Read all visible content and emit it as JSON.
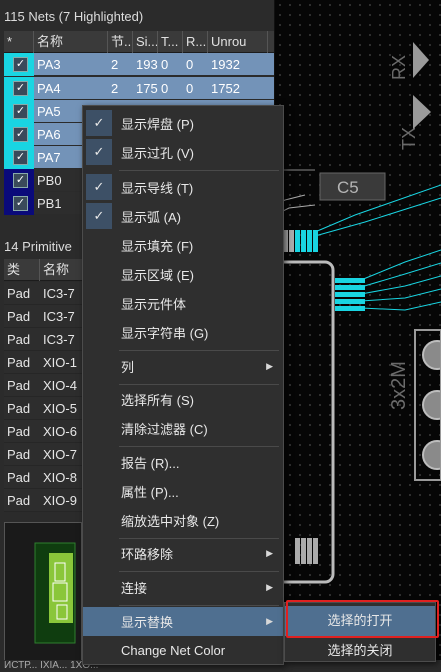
{
  "nets": {
    "title": "115 Nets (7 Highlighted)",
    "columns": [
      "*",
      "名称",
      "节...",
      "Si...",
      "T...",
      "R...",
      "Unrou"
    ],
    "rows": [
      {
        "name": "PA3",
        "nodes": "2",
        "signal": "193",
        "t": "0",
        "r": "0",
        "unrouted": "1932",
        "highlighted": true,
        "color": "#19d5e2"
      },
      {
        "name": "PA4",
        "nodes": "2",
        "signal": "175",
        "t": "0",
        "r": "0",
        "unrouted": "1752",
        "highlighted": true,
        "color": "#19d5e2"
      },
      {
        "name": "PA5",
        "nodes": "",
        "signal": "",
        "t": "",
        "r": "",
        "unrouted": "",
        "highlighted": true,
        "color": "#19d5e2"
      },
      {
        "name": "PA6",
        "nodes": "",
        "signal": "",
        "t": "",
        "r": "",
        "unrouted": "",
        "highlighted": true,
        "color": "#19d5e2"
      },
      {
        "name": "PA7",
        "nodes": "",
        "signal": "",
        "t": "",
        "r": "",
        "unrouted": "",
        "highlighted": true,
        "color": "#19d5e2"
      },
      {
        "name": "PB0",
        "nodes": "",
        "signal": "",
        "t": "",
        "r": "",
        "unrouted": "",
        "highlighted": false,
        "color": "#0a0a7a"
      },
      {
        "name": "PB1",
        "nodes": "",
        "signal": "",
        "t": "",
        "r": "",
        "unrouted": "",
        "highlighted": false,
        "color": "#0a0a7a"
      }
    ]
  },
  "primitives": {
    "title": "14 Primitive",
    "columns": [
      "类",
      "名称"
    ],
    "rows": [
      {
        "type": "Pad",
        "name": "IC3-7"
      },
      {
        "type": "Pad",
        "name": "IC3-7"
      },
      {
        "type": "Pad",
        "name": "IC3-7"
      },
      {
        "type": "Pad",
        "name": "XIO-1"
      },
      {
        "type": "Pad",
        "name": "XIO-4"
      },
      {
        "type": "Pad",
        "name": "XIO-5"
      },
      {
        "type": "Pad",
        "name": "XIO-6"
      },
      {
        "type": "Pad",
        "name": "XIO-7"
      },
      {
        "type": "Pad",
        "name": "XIO-8"
      },
      {
        "type": "Pad",
        "name": "XIO-9"
      }
    ]
  },
  "context_menu": {
    "items": [
      {
        "label": "显示焊盘 (P)",
        "checked": true,
        "submenu": false
      },
      {
        "label": "显示过孔 (V)",
        "checked": true,
        "submenu": false
      },
      {
        "label": "显示导线 (T)",
        "checked": true,
        "submenu": false
      },
      {
        "label": "显示弧 (A)",
        "checked": true,
        "submenu": false
      },
      {
        "label": "显示填充 (F)",
        "checked": false,
        "submenu": false
      },
      {
        "label": "显示区域 (E)",
        "checked": false,
        "submenu": false
      },
      {
        "label": "显示元件体",
        "checked": false,
        "submenu": false
      },
      {
        "label": "显示字符串 (G)",
        "checked": false,
        "submenu": false
      },
      {
        "label": "列",
        "checked": false,
        "submenu": true
      },
      {
        "label": "选择所有 (S)",
        "checked": false,
        "submenu": false
      },
      {
        "label": "清除过滤器 (C)",
        "checked": false,
        "submenu": false
      },
      {
        "label": "报告 (R)...",
        "checked": false,
        "submenu": false
      },
      {
        "label": "属性 (P)...",
        "checked": false,
        "submenu": false
      },
      {
        "label": "缩放选中对象 (Z)",
        "checked": false,
        "submenu": false
      },
      {
        "label": "环路移除",
        "checked": false,
        "submenu": true
      },
      {
        "label": "连接",
        "checked": false,
        "submenu": true
      },
      {
        "label": "显示替换",
        "checked": false,
        "submenu": true,
        "active": true
      },
      {
        "label": "Change Net Color",
        "checked": false,
        "submenu": false
      }
    ]
  },
  "submenu": {
    "items": [
      {
        "label": "选择的打开",
        "active": true
      },
      {
        "label": "选择的关闭",
        "active": false
      }
    ]
  },
  "pcb": {
    "labels": [
      "TX",
      "RX",
      "C5",
      "3x2M"
    ],
    "trace_color": "#19d5e2"
  },
  "status": "ИСТР... IXIA... 1XO..."
}
